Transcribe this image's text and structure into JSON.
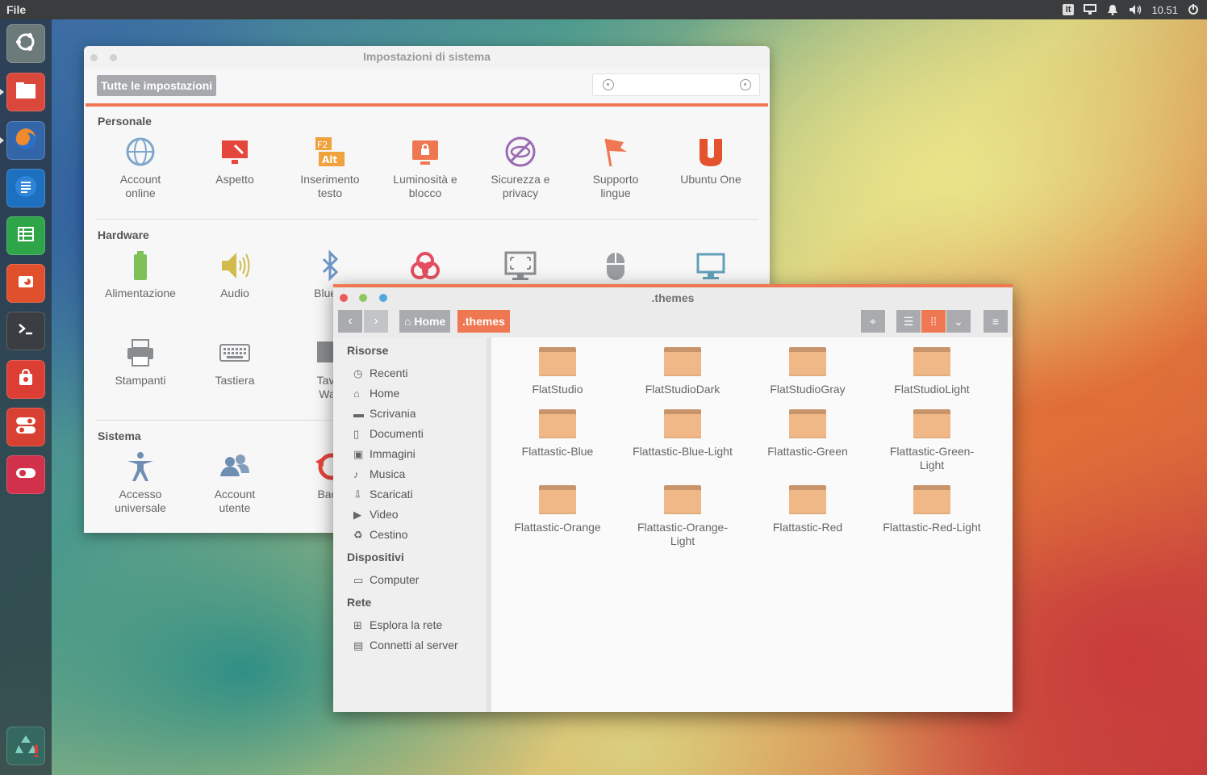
{
  "top_panel": {
    "menu": "File",
    "keyboard_layout": "It",
    "clock": "10.51"
  },
  "launcher": {
    "items": [
      {
        "name": "dash",
        "color": "#5b6b6a"
      },
      {
        "name": "files",
        "color": "#d9483b"
      },
      {
        "name": "firefox",
        "color": "#e8652b"
      },
      {
        "name": "writer",
        "color": "#1d6fbf"
      },
      {
        "name": "calc",
        "color": "#2da548"
      },
      {
        "name": "impress",
        "color": "#e1502c"
      },
      {
        "name": "terminal",
        "color": "#3a3d42"
      },
      {
        "name": "software-center",
        "color": "#dd3e33"
      },
      {
        "name": "system-settings",
        "color": "#d84032"
      },
      {
        "name": "screen-recorder",
        "color": "#d1314a"
      },
      {
        "name": "trash",
        "color": "#35695f"
      }
    ]
  },
  "settings_window": {
    "title": "Impostazioni di sistema",
    "all_settings_button": "Tutte le impostazioni",
    "sections": {
      "personal": {
        "title": "Personale",
        "items": [
          {
            "label": "Account\nonline",
            "icon": "globe-icon",
            "color": "#7fa6cc"
          },
          {
            "label": "Aspetto",
            "icon": "monitor-brush-icon",
            "color": "#e4463b"
          },
          {
            "label": "Inserimento\ntesto",
            "icon": "keyboard-keys-icon",
            "color": "#f0a23c"
          },
          {
            "label": "Luminosità e\nblocco",
            "icon": "lock-screen-icon",
            "color": "#ef7752"
          },
          {
            "label": "Sicurezza e\nprivacy",
            "icon": "privacy-eye-icon",
            "color": "#9b6ab4"
          },
          {
            "label": "Supporto\nlingue",
            "icon": "flag-icon",
            "color": "#ef7752"
          },
          {
            "label": "Ubuntu One",
            "icon": "ubuntu-one-icon",
            "color": "#e2532e"
          }
        ]
      },
      "hardware": {
        "title": "Hardware",
        "items": [
          {
            "label": "Alimentazione",
            "icon": "battery-icon",
            "color": "#7ec156"
          },
          {
            "label": "Audio",
            "icon": "speaker-icon",
            "color": "#d2bb4b"
          },
          {
            "label": "Blueto",
            "icon": "bluetooth-icon",
            "color": "#6f95c5"
          },
          {
            "label": "",
            "icon": "color-icon",
            "color": "#e44d5f"
          },
          {
            "label": "",
            "icon": "display-icon",
            "color": "#8a8d90"
          },
          {
            "label": "",
            "icon": "mouse-icon",
            "color": "#9a9da1"
          },
          {
            "label": "",
            "icon": "screen-icon",
            "color": "#62a0b8"
          },
          {
            "label": "Stampanti",
            "icon": "printer-icon",
            "color": "#8a8d90"
          },
          {
            "label": "Tastiera",
            "icon": "keyboard-icon",
            "color": "#8a8d90"
          },
          {
            "label": "Tavol\nWac",
            "icon": "tablet-icon",
            "color": "#8a8d90"
          }
        ]
      },
      "system": {
        "title": "Sistema",
        "items": [
          {
            "label": "Accesso\nuniversale",
            "icon": "accessibility-icon",
            "color": "#6f8fb2"
          },
          {
            "label": "Account\nutente",
            "icon": "users-icon",
            "color": "#6f8fb2"
          },
          {
            "label": "Back",
            "icon": "backup-icon",
            "color": "#e4463b"
          }
        ]
      }
    }
  },
  "files_window": {
    "title": ".themes",
    "breadcrumb": {
      "home": "Home",
      "current": ".themes"
    },
    "sidebar": {
      "resources_title": "Risorse",
      "resources": [
        {
          "label": "Recenti",
          "icon": "clock-icon"
        },
        {
          "label": "Home",
          "icon": "home-icon"
        },
        {
          "label": "Scrivania",
          "icon": "desktop-folder-icon"
        },
        {
          "label": "Documenti",
          "icon": "document-icon"
        },
        {
          "label": "Immagini",
          "icon": "image-icon"
        },
        {
          "label": "Musica",
          "icon": "music-icon"
        },
        {
          "label": "Scaricati",
          "icon": "download-icon"
        },
        {
          "label": "Video",
          "icon": "video-icon"
        },
        {
          "label": "Cestino",
          "icon": "trash-icon"
        }
      ],
      "devices_title": "Dispositivi",
      "devices": [
        {
          "label": "Computer",
          "icon": "computer-icon"
        }
      ],
      "network_title": "Rete",
      "network": [
        {
          "label": "Esplora la rete",
          "icon": "network-icon"
        },
        {
          "label": "Connetti al server",
          "icon": "server-icon"
        }
      ]
    },
    "folders": [
      "FlatStudio",
      "FlatStudioDark",
      "FlatStudioGray",
      "FlatStudioLight",
      "Flattastic-Blue",
      "Flattastic-Blue-Light",
      "Flattastic-Green",
      "Flattastic-Green-\nLight",
      "Flattastic-Orange",
      "Flattastic-Orange-\nLight",
      "Flattastic-Red",
      "Flattastic-Red-Light"
    ],
    "colors": {
      "accent": "#ef7752",
      "button": "#a9abae",
      "close": "#ee5a5a",
      "minimize": "#8cc862",
      "maximize": "#4fa8e0"
    }
  }
}
